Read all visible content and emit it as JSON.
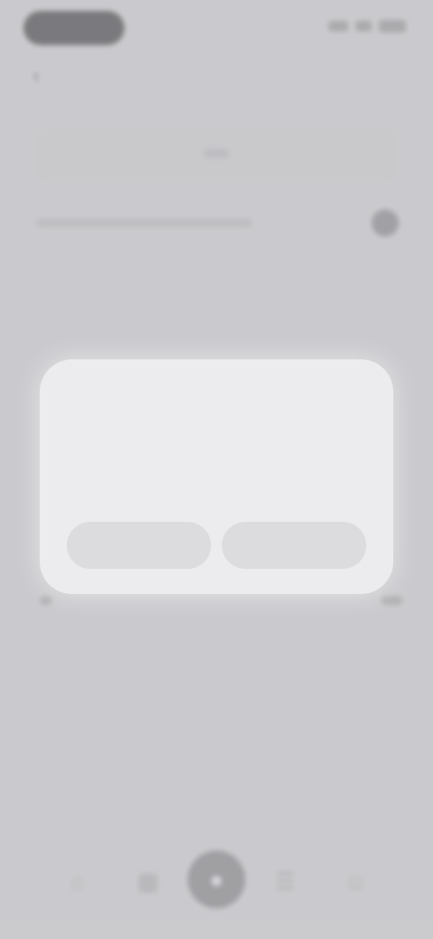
{
  "status_bar": {
    "time": "",
    "signal_icon": "signal-icon",
    "battery_icon": "battery-icon"
  },
  "nav": {
    "title": "",
    "back_icon": "chevron-left-icon"
  },
  "segment": {
    "left_tab": "",
    "right_tab": ""
  },
  "dialog": {
    "title": "",
    "body": "",
    "secondary_button": "",
    "primary_button": ""
  },
  "tab_bar": {
    "items": [
      {
        "icon": "home-icon"
      },
      {
        "icon": "grid-icon"
      },
      {
        "icon": "center-action-icon"
      },
      {
        "icon": "list-icon"
      },
      {
        "icon": "profile-icon"
      }
    ]
  },
  "colors": {
    "dialog_background": "#ececee",
    "scrim": "#c9c9cb",
    "button_background": "#dcdcde"
  }
}
